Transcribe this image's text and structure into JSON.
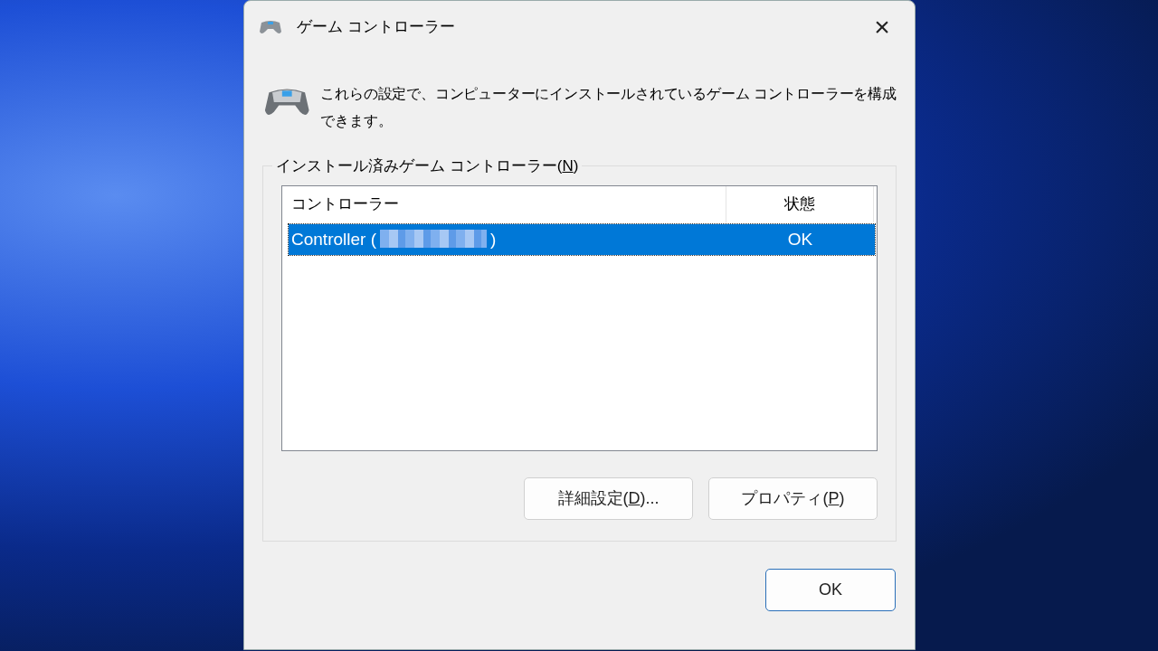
{
  "window": {
    "title": "ゲーム コントローラー",
    "close": "×"
  },
  "description": "これらの設定で、コンピューターにインストールされているゲーム コントローラーを構成できます。",
  "group": {
    "label_before": "インストール済みゲーム コントローラー(",
    "access_key": "N",
    "label_after": ")"
  },
  "table": {
    "columns": [
      "コントローラー",
      "状態"
    ],
    "rows": [
      {
        "name_before": "Controller (",
        "name_redacted": true,
        "name_after": ")",
        "status": "OK",
        "selected": true
      }
    ]
  },
  "buttons": [
    {
      "label_before": "詳細設定(",
      "access_key": "D",
      "label_after": ")...",
      "default": false
    },
    {
      "label_before": "プロパティ(",
      "access_key": "P",
      "label_after": ")",
      "default": false
    }
  ],
  "footer_buttons": [
    {
      "label_before": "OK",
      "default": true
    }
  ]
}
